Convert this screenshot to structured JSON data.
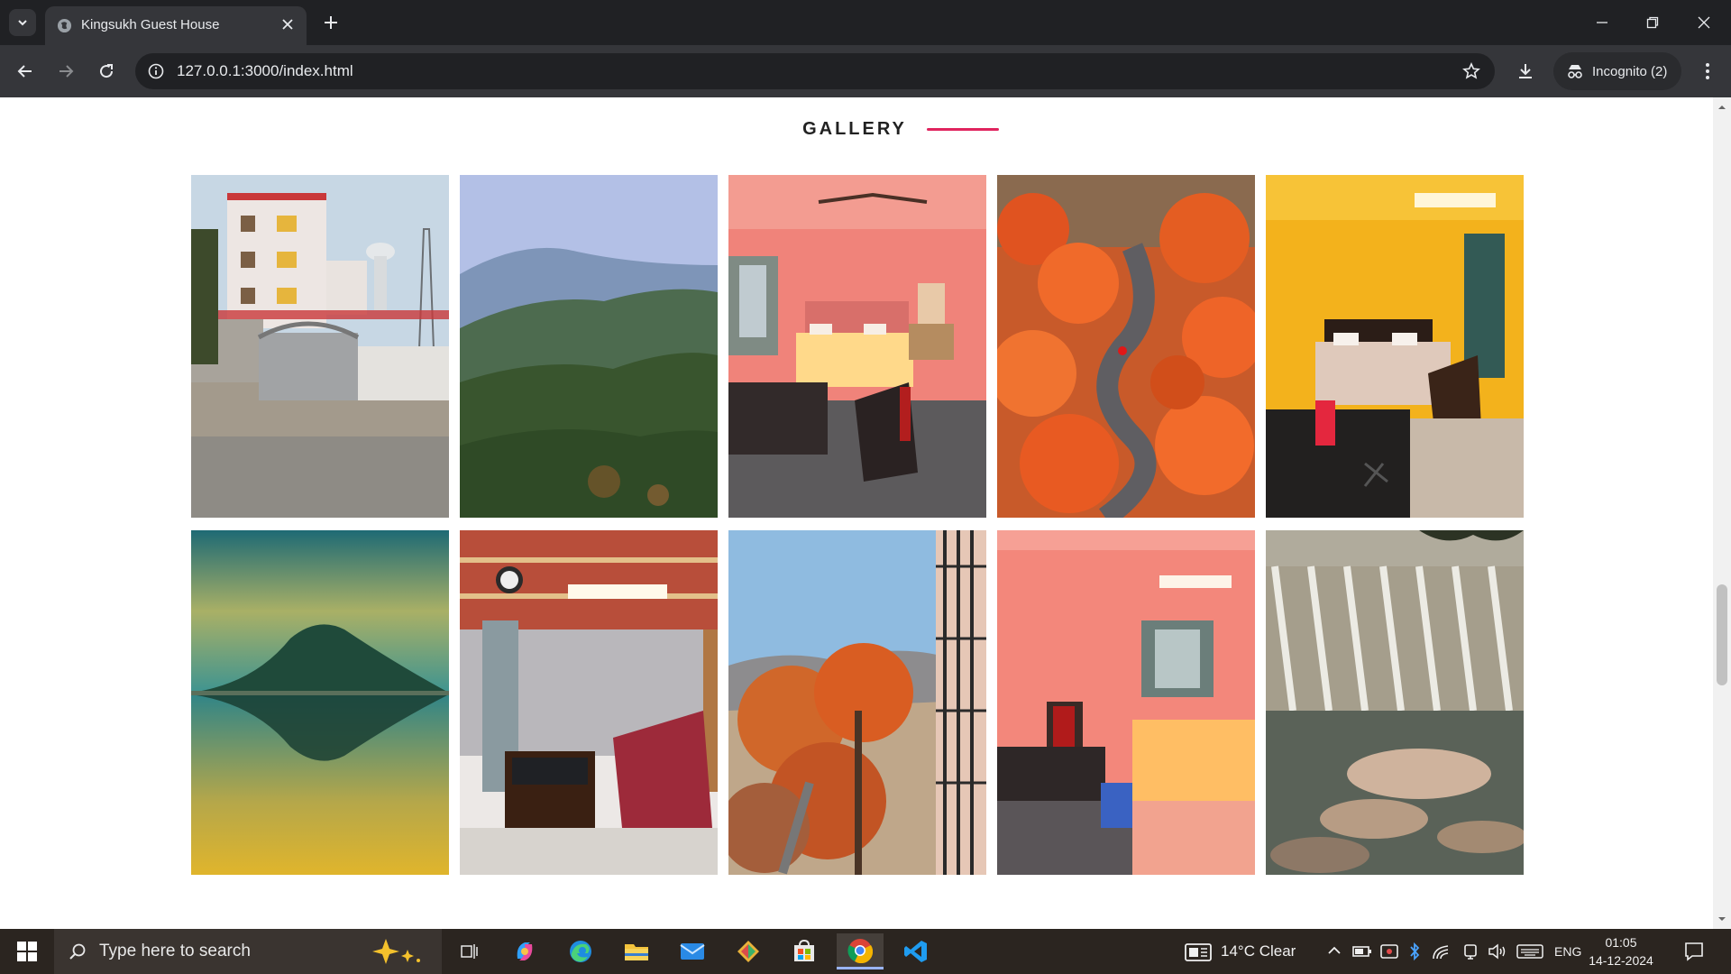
{
  "browser": {
    "tab_title": "Kingsukh Guest House",
    "url": "127.0.0.1:3000/index.html",
    "incognito_label": "Incognito (2)"
  },
  "page": {
    "section_title": "GALLERY",
    "accent_color": "#e0245e",
    "gallery": [
      {
        "name": "guest-house-front-photo"
      },
      {
        "name": "forest-hills-photo"
      },
      {
        "name": "pink-bedroom-photo"
      },
      {
        "name": "palash-road-photo"
      },
      {
        "name": "yellow-bedroom-photo"
      },
      {
        "name": "hill-lake-reflection-photo"
      },
      {
        "name": "lounge-sofa-photo"
      },
      {
        "name": "palash-tree-window-photo"
      },
      {
        "name": "pink-room-bed-photo"
      },
      {
        "name": "dam-river-photo"
      }
    ]
  },
  "taskbar": {
    "search_placeholder": "Type here to search",
    "weather": "14°C  Clear",
    "language": "ENG",
    "time": "01:05",
    "date": "14-12-2024"
  }
}
